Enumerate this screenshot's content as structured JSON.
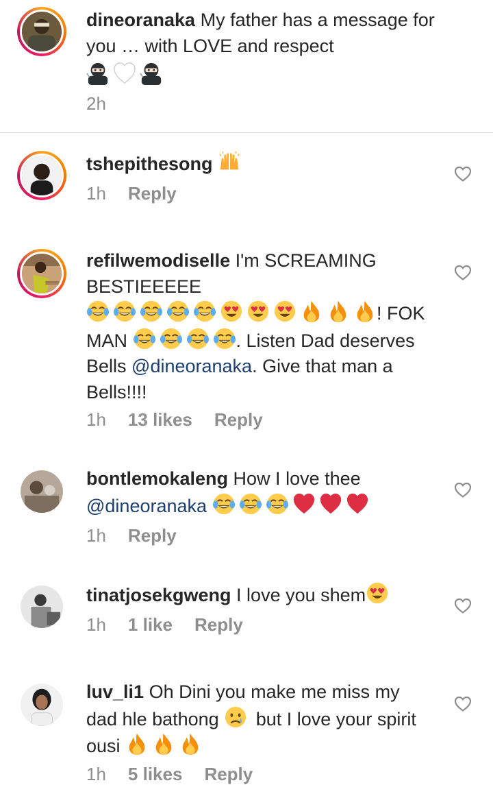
{
  "caption": {
    "username": "dineoranaka",
    "text": "My father has a message for you … with LOVE and respect",
    "emoji_line": [
      "ninja",
      "white-heart",
      "ninja"
    ],
    "time": "2h"
  },
  "comments": [
    {
      "username": "tshepithesong",
      "text": "",
      "emojis": [
        "raising-hands"
      ],
      "time": "1h",
      "likes": "",
      "reply": "Reply"
    },
    {
      "username": "refilwemodiselle",
      "text_1": "I'm SCREAMING BESTIEEEEE",
      "emojis_1": [
        "tears-of-joy",
        "tears-of-joy",
        "tears-of-joy",
        "tears-of-joy",
        "tears-of-joy",
        "heart-eyes",
        "heart-eyes",
        "heart-eyes",
        "fire",
        "fire",
        "fire"
      ],
      "text_2": "! FOK MAN",
      "emojis_2": [
        "tears-of-joy",
        "tears-of-joy",
        "tears-of-joy",
        "tears-of-joy"
      ],
      "text_3": ". Listen Dad deserves Bells",
      "mention": "@dineoranaka",
      "text_4": ". Give that man a Bells!!!!",
      "time": "1h",
      "likes": "13 likes",
      "reply": "Reply"
    },
    {
      "username": "bontlemokaleng",
      "text": "How I love thee",
      "mention": "@dineoranaka",
      "emojis": [
        "tears-of-joy",
        "tears-of-joy",
        "tears-of-joy",
        "red-heart",
        "red-heart",
        "red-heart"
      ],
      "time": "1h",
      "likes": "",
      "reply": "Reply"
    },
    {
      "username": "tinatjosekgweng",
      "text": "I love you shem",
      "emojis": [
        "heart-eyes"
      ],
      "time": "1h",
      "likes": "1 like",
      "reply": "Reply"
    },
    {
      "username": "luv_li1",
      "text_1": "Oh Dini you make me miss my dad hle bathong",
      "emojis_1": [
        "crying-face"
      ],
      "text_2": "but I love your spirit ousi",
      "emojis_2": [
        "fire",
        "fire",
        "fire"
      ],
      "time": "1h",
      "likes": "5 likes",
      "reply": "Reply"
    }
  ],
  "colors": {
    "ring_start": "#f9a825",
    "ring_end": "#c2185b",
    "mention": "#1c3f70",
    "meta": "#8e8e8e"
  }
}
